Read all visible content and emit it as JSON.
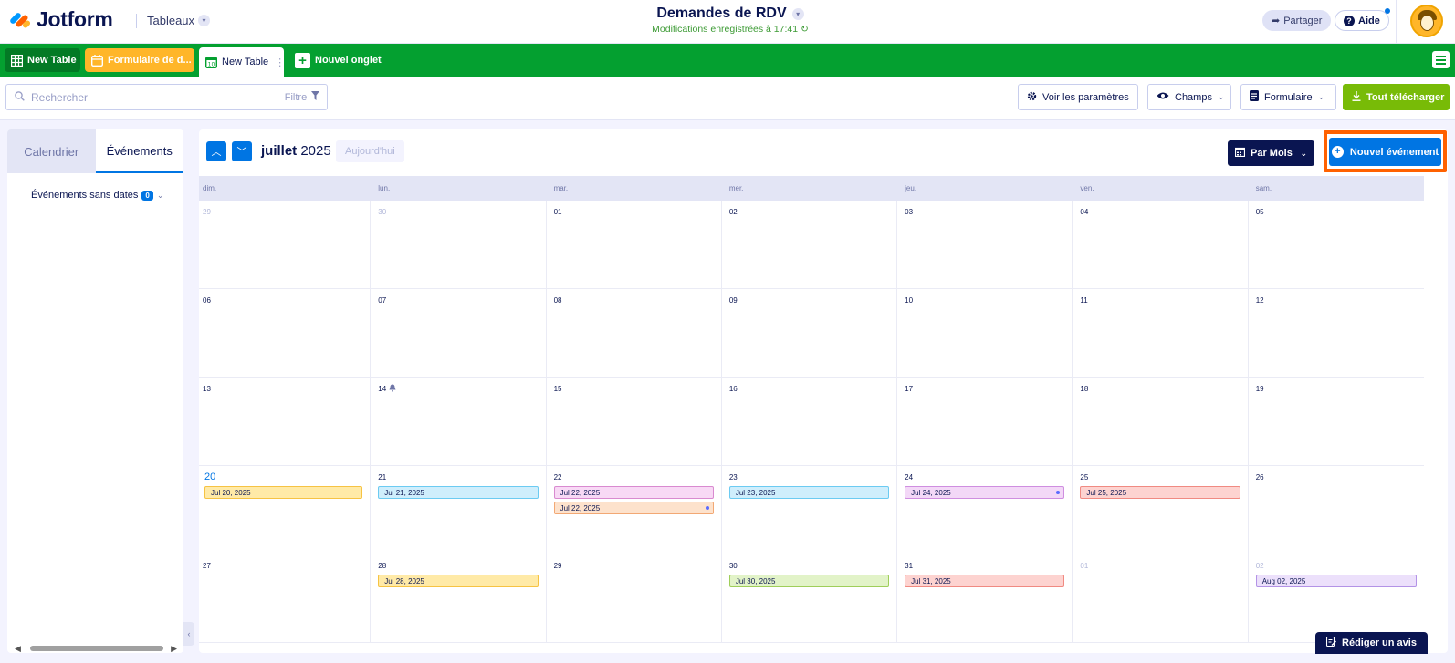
{
  "header": {
    "brand": "Jotform",
    "product": "Tableaux",
    "title": "Demandes de RDV",
    "saved_status": "Modifications enregistrées à 17:41",
    "share_label": "Partager",
    "help_label": "Aide"
  },
  "tabs": [
    {
      "label": "New Table",
      "color": "#037a25"
    },
    {
      "label": "Formulaire de d...",
      "color": "#ffb629"
    },
    {
      "label": "New Table",
      "color": "#ffffff"
    },
    {
      "label": "Nouvel onglet",
      "color": "transparent"
    }
  ],
  "toolbar": {
    "search_placeholder": "Rechercher",
    "filter_label": "Filtre",
    "settings_label": "Voir les paramètres",
    "fields_label": "Champs",
    "form_label": "Formulaire",
    "download_label": "Tout télécharger"
  },
  "left_panel": {
    "tab_calendar": "Calendrier",
    "tab_events": "Événements",
    "undated_label": "Événements sans dates",
    "undated_count": "0"
  },
  "calendar": {
    "month": "juillet",
    "year": "2025",
    "today_label": "Aujourd'hui",
    "view_label": "Par Mois",
    "new_event_label": "Nouvel événement",
    "weekdays": [
      "dim.",
      "lun.",
      "mar.",
      "mer.",
      "jeu.",
      "ven.",
      "sam."
    ],
    "days": [
      {
        "num": "29",
        "other": true
      },
      {
        "num": "30",
        "other": true
      },
      {
        "num": "01"
      },
      {
        "num": "02"
      },
      {
        "num": "03"
      },
      {
        "num": "04"
      },
      {
        "num": "05"
      },
      {
        "num": "06"
      },
      {
        "num": "07"
      },
      {
        "num": "08"
      },
      {
        "num": "09"
      },
      {
        "num": "10"
      },
      {
        "num": "11"
      },
      {
        "num": "12"
      },
      {
        "num": "13"
      },
      {
        "num": "14",
        "bell": true
      },
      {
        "num": "15"
      },
      {
        "num": "16"
      },
      {
        "num": "17"
      },
      {
        "num": "18"
      },
      {
        "num": "19"
      },
      {
        "num": "20",
        "today": true,
        "events": [
          {
            "label": "Jul 20, 2025",
            "bg": "#ffeaa7",
            "border": "#f6c343"
          }
        ]
      },
      {
        "num": "21",
        "events": [
          {
            "label": "Jul 21, 2025",
            "bg": "#cfeefc",
            "border": "#6ccbf2"
          }
        ]
      },
      {
        "num": "22",
        "events": [
          {
            "label": "Jul 22, 2025",
            "bg": "#f8d9f5",
            "border": "#d98ad0"
          },
          {
            "label": "Jul 22, 2025",
            "bg": "#fde2cc",
            "border": "#f2a874",
            "dot": true
          }
        ]
      },
      {
        "num": "23",
        "events": [
          {
            "label": "Jul 23, 2025",
            "bg": "#cfeefc",
            "border": "#6ccbf2"
          }
        ]
      },
      {
        "num": "24",
        "events": [
          {
            "label": "Jul 24, 2025",
            "bg": "#f3d8f7",
            "border": "#cf8ee0",
            "dot": true
          }
        ]
      },
      {
        "num": "25",
        "events": [
          {
            "label": "Jul 25, 2025",
            "bg": "#fdd3d0",
            "border": "#f08a82"
          }
        ]
      },
      {
        "num": "26"
      },
      {
        "num": "27"
      },
      {
        "num": "28",
        "events": [
          {
            "label": "Jul 28, 2025",
            "bg": "#ffeaa7",
            "border": "#f6c343"
          }
        ]
      },
      {
        "num": "29"
      },
      {
        "num": "30",
        "events": [
          {
            "label": "Jul 30, 2025",
            "bg": "#e2f3c8",
            "border": "#9fce5a"
          }
        ]
      },
      {
        "num": "31",
        "events": [
          {
            "label": "Jul 31, 2025",
            "bg": "#fdd3d0",
            "border": "#f08a82"
          }
        ]
      },
      {
        "num": "01",
        "other": true
      },
      {
        "num": "02",
        "other": true,
        "events": [
          {
            "label": "Aug 02, 2025",
            "bg": "#ece0fb",
            "border": "#b393e6"
          }
        ]
      }
    ]
  },
  "review_label": "Rédiger un avis",
  "colors": {
    "accent": "#0075e3",
    "tabbar": "#04a030",
    "highlight": "#ff6100",
    "download": "#78bb07"
  }
}
